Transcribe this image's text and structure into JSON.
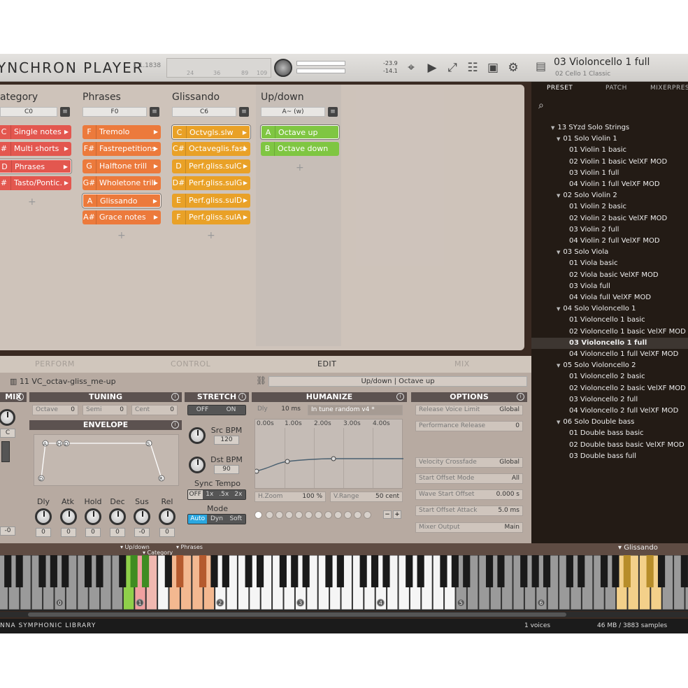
{
  "header": {
    "logo": "YNCHRON PLAYER",
    "version": "1.1.1838",
    "meter_ticks": [
      "24",
      "36",
      "89",
      "109"
    ],
    "level_top": "-23.9",
    "level_bottom": "-14.1",
    "preset_name": "03 Violoncello 1 full",
    "preset_sub": "02 Cello 1 Classic"
  },
  "matrix": {
    "columns": [
      {
        "title": "ategory",
        "selector": "C0",
        "cells": [
          {
            "key": "C",
            "label": "Single notes",
            "color": "#e3574f"
          },
          {
            "key": "#",
            "label": "Multi shorts",
            "color": "#e3574f"
          },
          {
            "key": "D",
            "label": "Phrases",
            "color": "#e3574f",
            "selected": true
          },
          {
            "key": "#",
            "label": "Tasto/Pontic.",
            "color": "#e3574f"
          }
        ]
      },
      {
        "title": "Phrases",
        "selector": "F0",
        "cells": [
          {
            "key": "F",
            "label": "Tremolo",
            "color": "#ec7a3c"
          },
          {
            "key": "F#",
            "label": "Fastrepetitions",
            "color": "#ec7a3c"
          },
          {
            "key": "G",
            "label": "Halftone trill",
            "color": "#ec7a3c"
          },
          {
            "key": "G#",
            "label": "Wholetone trill",
            "color": "#ec7a3c"
          },
          {
            "key": "A",
            "label": "Glissando",
            "color": "#ec7a3c",
            "selected": true
          },
          {
            "key": "A#",
            "label": "Grace notes",
            "color": "#ec7a3c"
          }
        ]
      },
      {
        "title": "Glissando",
        "selector": "C6",
        "cells": [
          {
            "key": "C",
            "label": "Octvgls.slw",
            "color": "#e9a127",
            "selected": true
          },
          {
            "key": "C#",
            "label": "Octaveglis.fast",
            "color": "#e9a127"
          },
          {
            "key": "D",
            "label": "Perf.gliss.sulC",
            "color": "#e9a127"
          },
          {
            "key": "D#",
            "label": "Perf.gliss.sulG",
            "color": "#e9a127"
          },
          {
            "key": "E",
            "label": "Perf.gliss.sulD",
            "color": "#e9a127"
          },
          {
            "key": "F",
            "label": "Perf.gliss.sulA",
            "color": "#e9a127"
          }
        ]
      },
      {
        "title": "Up/down",
        "selector": "A~ (w)",
        "cells": [
          {
            "key": "A",
            "label": "Octave up",
            "color": "#7fc642",
            "selected": true
          },
          {
            "key": "B",
            "label": "Octave down",
            "color": "#7fc642"
          }
        ]
      }
    ]
  },
  "tabs": [
    "PERFORM",
    "CONTROL",
    "EDIT",
    "MIX"
  ],
  "active_tab": "EDIT",
  "edit": {
    "patch_name": "11 VC_octav-gliss_me-up",
    "patch_path": "Up/down | Octave up",
    "mix": {
      "title": "MIX",
      "pan": "C",
      "value": "-0"
    },
    "tuning": {
      "title": "TUNING",
      "fields": [
        {
          "label": "Octave",
          "value": "0"
        },
        {
          "label": "Semi",
          "value": "0"
        },
        {
          "label": "Cent",
          "value": "0"
        }
      ]
    },
    "envelope": {
      "title": "ENVELOPE",
      "points": [
        "A",
        "H",
        "D",
        "S",
        "R",
        "D"
      ],
      "knobs": [
        {
          "label": "Dly",
          "value": "0"
        },
        {
          "label": "Atk",
          "value": "0"
        },
        {
          "label": "Hold",
          "value": "0"
        },
        {
          "label": "Dec",
          "value": "0"
        },
        {
          "label": "Sus",
          "value": "-0"
        },
        {
          "label": "Rel",
          "value": "0"
        }
      ]
    },
    "stretch": {
      "title": "STRETCH",
      "off": "OFF",
      "on": "ON",
      "src_label": "Src BPM",
      "src_value": "120",
      "dst_label": "Dst BPM",
      "dst_value": "90",
      "sync_label": "Sync Tempo",
      "sync_opts": [
        "OFF",
        "1x",
        ".5x",
        "2x"
      ],
      "mode_label": "Mode",
      "mode_opts": [
        "Auto",
        "Dyn",
        "Soft"
      ]
    },
    "humanize": {
      "title": "HUMANIZE",
      "dly_label": "Dly",
      "dly_value": "10 ms",
      "preset": "In tune random v4 *",
      "times": [
        "0.00s",
        "1.00s",
        "2.00s",
        "3.00s",
        "4.00s"
      ],
      "hzoom_label": "H.Zoom",
      "hzoom_value": "100 %",
      "vrange_label": "V.Range",
      "vrange_value": "50 cent"
    },
    "options": {
      "title": "OPTIONS",
      "rows": [
        {
          "label": "Release Voice Limit",
          "value": "Global"
        },
        {
          "label": "Performance Release",
          "value": "0"
        },
        {
          "label": "Velocity Crossfade",
          "value": "Global"
        },
        {
          "label": "Start Offset Mode",
          "value": "All"
        },
        {
          "label": "Wave Start Offset",
          "value": "0.000 s"
        },
        {
          "label": "Start Offset Attack",
          "value": "5.0 ms"
        },
        {
          "label": "Mixer Output",
          "value": "Main"
        }
      ]
    }
  },
  "browser": {
    "tabs": [
      "PRESET",
      "PATCH",
      "MIXERPRES"
    ],
    "tree": [
      {
        "label": "13 SYzd Solo Strings",
        "level": 0,
        "folder": true
      },
      {
        "label": "01 Solo Violin 1",
        "level": 1,
        "folder": true
      },
      {
        "label": "01 Violin 1 basic",
        "level": 2
      },
      {
        "label": "02 Violin 1 basic VelXF MOD",
        "level": 2
      },
      {
        "label": "03 Violin 1 full",
        "level": 2
      },
      {
        "label": "04 Violin 1 full VelXF MOD",
        "level": 2
      },
      {
        "label": "02 Solo Violin 2",
        "level": 1,
        "folder": true
      },
      {
        "label": "01 Violin 2 basic",
        "level": 2
      },
      {
        "label": "02 Violin 2 basic VelXF MOD",
        "level": 2
      },
      {
        "label": "03 Violin 2 full",
        "level": 2
      },
      {
        "label": "04 Violin 2 full VelXF MOD",
        "level": 2
      },
      {
        "label": "03 Solo Viola",
        "level": 1,
        "folder": true
      },
      {
        "label": "01 Viola basic",
        "level": 2
      },
      {
        "label": "02 Viola basic VelXF MOD",
        "level": 2
      },
      {
        "label": "03 Viola full",
        "level": 2
      },
      {
        "label": "04 Viola full VelXF MOD",
        "level": 2
      },
      {
        "label": "04 Solo Violoncello 1",
        "level": 1,
        "folder": true
      },
      {
        "label": "01 Violoncello 1 basic",
        "level": 2
      },
      {
        "label": "02 Violoncello 1 basic VelXF MOD",
        "level": 2
      },
      {
        "label": "03 Violoncello 1 full",
        "level": 2,
        "selected": true
      },
      {
        "label": "04 Violoncello 1 full VelXF MOD",
        "level": 2
      },
      {
        "label": "05 Solo Violoncello 2",
        "level": 1,
        "folder": true
      },
      {
        "label": "01 Violoncello 2 basic",
        "level": 2
      },
      {
        "label": "02 Violoncello 2 basic VelXF MOD",
        "level": 2
      },
      {
        "label": "03 Violoncello 2 full",
        "level": 2
      },
      {
        "label": "04 Violoncello 2 full VelXF MOD",
        "level": 2
      },
      {
        "label": "06 Solo Double bass",
        "level": 1,
        "folder": true
      },
      {
        "label": "01 Double bass basic",
        "level": 2
      },
      {
        "label": "02 Double bass basic VelXF MOD",
        "level": 2
      },
      {
        "label": "03 Double bass full",
        "level": 2
      }
    ]
  },
  "keyboard": {
    "labels": [
      {
        "text": "▾ Up/down"
      },
      {
        "text": "▾ Category"
      },
      {
        "text": "▾ Phrases"
      },
      {
        "text": "▾ Glissando"
      }
    ],
    "octave_markers": [
      "0",
      "1",
      "2",
      "3",
      "4",
      "5",
      "6"
    ]
  },
  "footer": {
    "library": "NNA SYMPHONIC LIBRARY",
    "voices": "1 voices",
    "memory": "46 MB / 3883 samples"
  }
}
